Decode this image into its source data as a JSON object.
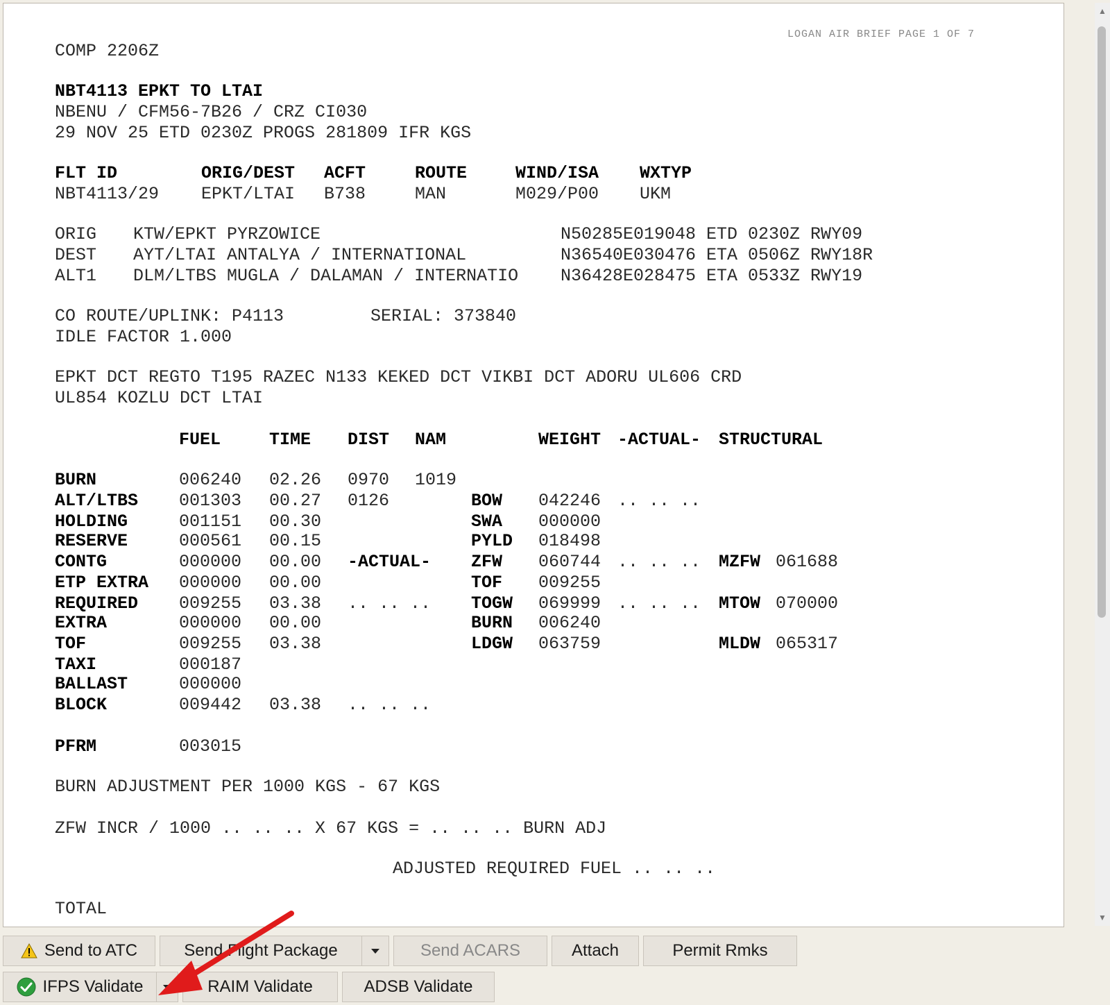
{
  "document": {
    "header_note": "LOGAN AIR BRIEF PAGE 1 OF 7",
    "comp": "COMP 2206Z",
    "flight_title": "NBT4113 EPKT TO LTAI",
    "aircraft_line": "NBENU / CFM56-7B26 / CRZ CI030",
    "date_line": "29 NOV 25 ETD 0230Z PROGS 281809 IFR KGS",
    "summary": {
      "headers": [
        "FLT ID",
        "ORIG/DEST",
        "ACFT",
        "ROUTE",
        "WIND/ISA",
        "WXTYP"
      ],
      "values": [
        "NBT4113/29",
        "EPKT/LTAI",
        "B738",
        "MAN",
        "M029/P00",
        "UKM"
      ]
    },
    "airports": [
      {
        "label": "ORIG",
        "name": "KTW/EPKT PYRZOWICE",
        "coords": "N50285E019048 ETD 0230Z RWY09"
      },
      {
        "label": "DEST",
        "name": "AYT/LTAI ANTALYA / INTERNATIONAL",
        "coords": "N36540E030476 ETA 0506Z RWY18R"
      },
      {
        "label": "ALT1",
        "name": "DLM/LTBS MUGLA / DALAMAN / INTERNATIO",
        "coords": "N36428E028475 ETA 0533Z RWY19"
      }
    ],
    "co_route": "CO ROUTE/UPLINK: P4113",
    "serial": "SERIAL: 373840",
    "idle_factor": "IDLE FACTOR 1.000",
    "route_line1": "EPKT DCT REGTO T195 RAZEC N133 KEKED DCT VIKBI DCT ADORU UL606 CRD",
    "route_line2": "UL854 KOZLU DCT LTAI",
    "fuel_headers": {
      "fuel": "FUEL",
      "time": "TIME",
      "dist": "DIST",
      "nam": "NAM",
      "weight": "WEIGHT",
      "actual": "-ACTUAL-",
      "structural": "STRUCTURAL"
    },
    "fuel_rows": [
      {
        "label": "BURN",
        "fuel": "006240",
        "time": "02.26",
        "dist": "0970",
        "nam": "1019"
      },
      {
        "label": "ALT/LTBS",
        "fuel": "001303",
        "time": "00.27",
        "dist": "0126"
      },
      {
        "label": "HOLDING",
        "fuel": "001151",
        "time": "00.30"
      },
      {
        "label": "RESERVE",
        "fuel": "000561",
        "time": "00.15"
      },
      {
        "label": "CONTG",
        "fuel": "000000",
        "time": "00.00",
        "dist": "-ACTUAL-"
      },
      {
        "label": "ETP EXTRA",
        "fuel": "000000",
        "time": "00.00"
      },
      {
        "label": "REQUIRED",
        "fuel": "009255",
        "time": "03.38",
        "dist": ".. .. .."
      },
      {
        "label": "EXTRA",
        "fuel": "000000",
        "time": "00.00"
      },
      {
        "label": "TOF",
        "fuel": "009255",
        "time": "03.38"
      },
      {
        "label": "TAXI",
        "fuel": "000187"
      },
      {
        "label": "BALLAST",
        "fuel": "000000"
      },
      {
        "label": "BLOCK",
        "fuel": "009442",
        "time": "03.38",
        "dist": ".. .. .."
      }
    ],
    "weight_rows": [
      {
        "label": "BOW",
        "value": "042246",
        "actual": ".. .. .."
      },
      {
        "label": "SWA",
        "value": "000000"
      },
      {
        "label": "PYLD",
        "value": "018498"
      },
      {
        "label": "ZFW",
        "value": "060744",
        "actual": ".. .. ..",
        "struct_label": "MZFW",
        "struct_value": "061688"
      },
      {
        "label": "TOF",
        "value": "009255"
      },
      {
        "label": "TOGW",
        "value": "069999",
        "actual": ".. .. ..",
        "struct_label": "MTOW",
        "struct_value": "070000"
      },
      {
        "label": "BURN",
        "value": "006240"
      },
      {
        "label": "LDGW",
        "value": "063759",
        "struct_label": "MLDW",
        "struct_value": "065317"
      }
    ],
    "pfrm_label": "PFRM",
    "pfrm_value": "003015",
    "burn_adjustment": "BURN ADJUSTMENT PER 1000 KGS - 67 KGS",
    "zfw_incr": "ZFW INCR / 1000 .. .. .. X 67 KGS = .. .. .. BURN ADJ",
    "adjusted_required": "ADJUSTED REQUIRED FUEL .. .. ..",
    "total_partial": "TOTAL"
  },
  "toolbar": {
    "send_atc": "Send to ATC",
    "send_flight_package": "Send Flight Package",
    "send_acars": "Send ACARS",
    "attach": "Attach",
    "permit_rmks": "Permit Rmks",
    "ifps_validate": "IFPS Validate",
    "raim_validate": "RAIM Validate",
    "adsb_validate": "ADSB Validate"
  },
  "icons": {
    "warning": "warning-icon",
    "ok": "check-circle-icon",
    "dropdown": "chevron-down-icon",
    "annotation": "red-arrow"
  },
  "colors": {
    "warning": "#f5c518",
    "ok": "#2e9e3e",
    "annotation": "#e01b1b"
  }
}
